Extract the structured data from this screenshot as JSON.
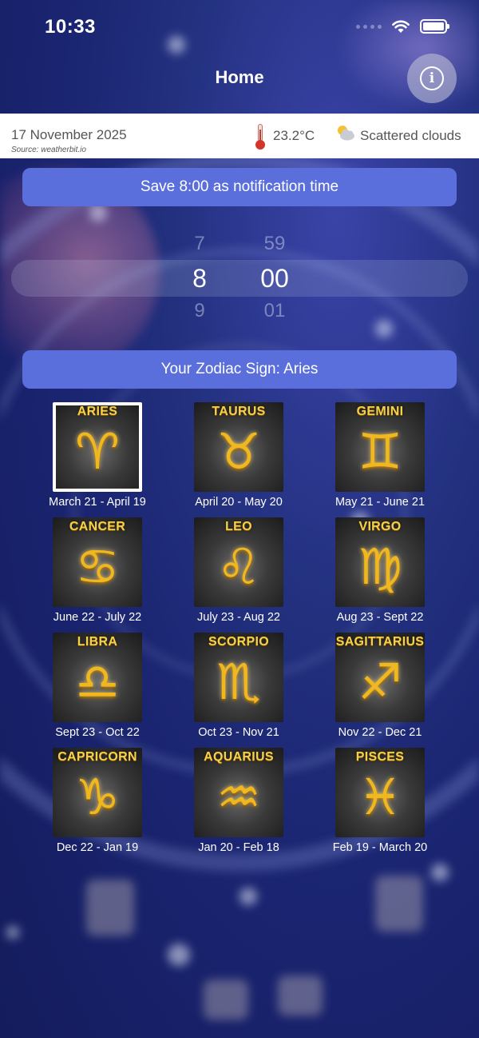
{
  "status_bar": {
    "time": "10:33"
  },
  "nav": {
    "title": "Home"
  },
  "weather": {
    "date": "17 November 2025",
    "source": "Source: weatherbit.io",
    "temperature": "23.2°C",
    "condition": "Scattered clouds"
  },
  "notification": {
    "save_label": "Save 8:00 as notification time"
  },
  "time_picker": {
    "hours": {
      "above": "7",
      "selected": "8",
      "below": "9"
    },
    "minutes": {
      "above": "59",
      "selected": "00",
      "below": "01"
    }
  },
  "zodiac": {
    "header_label": "Your Zodiac Sign: Aries",
    "selected": "Aries",
    "signs": [
      {
        "name": "ARIES",
        "glyph": "♈",
        "range": "March 21 - April 19"
      },
      {
        "name": "TAURUS",
        "glyph": "♉",
        "range": "April 20 - May 20"
      },
      {
        "name": "GEMINI",
        "glyph": "♊",
        "range": "May 21 - June 21"
      },
      {
        "name": "CANCER",
        "glyph": "♋",
        "range": "June 22 - July 22"
      },
      {
        "name": "LEO",
        "glyph": "♌",
        "range": "July 23 - Aug 22"
      },
      {
        "name": "VIRGO",
        "glyph": "♍",
        "range": "Aug 23 - Sept 22"
      },
      {
        "name": "LIBRA",
        "glyph": "♎",
        "range": "Sept 23 - Oct 22"
      },
      {
        "name": "SCORPIO",
        "glyph": "♏",
        "range": "Oct 23 - Nov 21"
      },
      {
        "name": "SAGITTARIUS",
        "glyph": "♐",
        "range": "Nov 22 - Dec 21"
      },
      {
        "name": "CAPRICORN",
        "glyph": "♑",
        "range": "Dec 22 - Jan 19"
      },
      {
        "name": "AQUARIUS",
        "glyph": "♒",
        "range": "Jan 20 - Feb 18"
      },
      {
        "name": "PISCES",
        "glyph": "♓",
        "range": "Feb 19 - March 20"
      }
    ]
  },
  "colors": {
    "accent_button": "#5b6fdc",
    "background": "#1a2470",
    "sign_gold": "#f7d04a"
  }
}
